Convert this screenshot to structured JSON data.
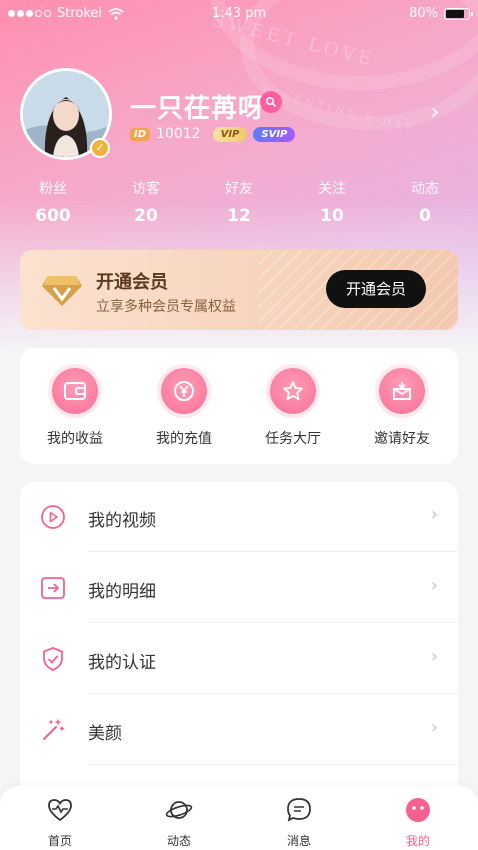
{
  "status_bar": {
    "carrier": "Strokei",
    "time": "1:43 pm",
    "battery": "80%",
    "battery_level": 0.8
  },
  "header": {
    "watermark_line1": "SWEET LOVE",
    "watermark_line2": "VALENTINE'S DAY",
    "nickname": "一只茌苒呀",
    "id_tag": "ID",
    "id_number": "10012",
    "vip_label": "VIP",
    "svip_label": "SVIP",
    "verified_icon": "check-badge-icon",
    "gender_icon": "female-icon"
  },
  "stats": [
    {
      "label": "粉丝",
      "value": "600"
    },
    {
      "label": "访客",
      "value": "20"
    },
    {
      "label": "好友",
      "value": "12"
    },
    {
      "label": "关注",
      "value": "10"
    },
    {
      "label": "动态",
      "value": "0"
    }
  ],
  "vip_banner": {
    "title": "开通会员",
    "subtitle": "立享多种会员专属权益",
    "button": "开通会员",
    "icon": "diamond-icon"
  },
  "quick_actions": [
    {
      "label": "我的收益",
      "icon": "wallet-icon"
    },
    {
      "label": "我的充值",
      "icon": "yen-coin-icon"
    },
    {
      "label": "任务大厅",
      "icon": "star-icon"
    },
    {
      "label": "邀请好友",
      "icon": "gift-box-icon"
    }
  ],
  "menu": [
    {
      "label": "我的视频",
      "icon": "play-circle-icon"
    },
    {
      "label": "我的明细",
      "icon": "arrow-box-icon"
    },
    {
      "label": "我的认证",
      "icon": "shield-check-icon"
    },
    {
      "label": "美颜",
      "icon": "magic-wand-icon"
    }
  ],
  "tabs": [
    {
      "label": "首页",
      "icon": "heartbeat-icon",
      "active": false
    },
    {
      "label": "动态",
      "icon": "planet-icon",
      "active": false
    },
    {
      "label": "消息",
      "icon": "chat-bubble-icon",
      "active": false
    },
    {
      "label": "我的",
      "icon": "smiley-face-icon",
      "active": true
    }
  ],
  "colors": {
    "accent": "#f6628d",
    "vip_button": "#111111"
  }
}
